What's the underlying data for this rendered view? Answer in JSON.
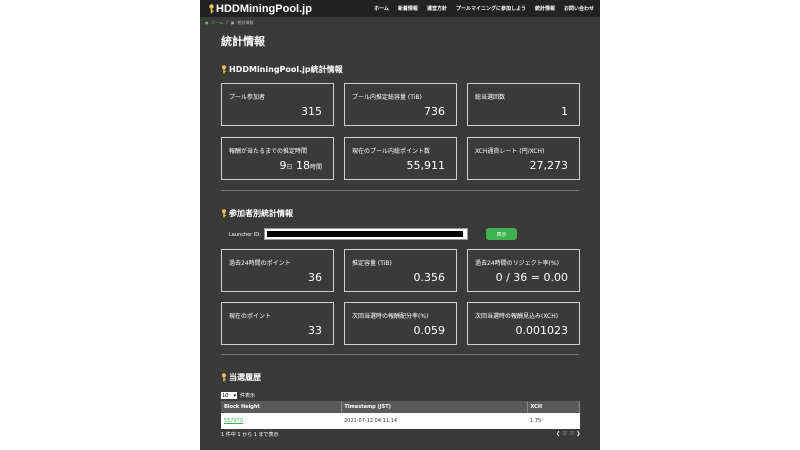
{
  "header": {
    "brand": "HDDMiningPool.jp",
    "nav": [
      "ホーム",
      "新着情報",
      "運営方針",
      "プールマイニングに参加しよう",
      "統計情報",
      "お問い合わせ"
    ]
  },
  "breadcrumb": {
    "home": "ホーム",
    "separator": "/",
    "current": "統計情報"
  },
  "page_title": "統計情報",
  "pool_stats": {
    "title": "HDDMiningPool.jp統計情報",
    "cards": [
      {
        "label": "プール参加者",
        "value": "315"
      },
      {
        "label": "プール内推定総容量 (TiB)",
        "value": "736"
      },
      {
        "label": "総当選回数",
        "value": "1"
      },
      {
        "label": "報酬が当たるまでの推定時間",
        "days": "9",
        "days_unit": "日",
        "hours": "18",
        "hours_unit": "時間"
      },
      {
        "label": "現在のプール内総ポイント数",
        "value": "55,911"
      },
      {
        "label": "XCH通貨レート (円/XCH)",
        "value": "27,273"
      }
    ]
  },
  "participant_stats": {
    "title": "参加者別統計情報",
    "launcher_label": "Launcher ID:",
    "show_button": "表示",
    "cards": [
      {
        "label": "過去24時間のポイント",
        "value": "36"
      },
      {
        "label": "推定容量 (TiB)",
        "value": "0.356"
      },
      {
        "label": "過去24時間のリジェクト率(%)",
        "value": "0 / 36 = 0.00"
      },
      {
        "label": "現在のポイント",
        "value": "33"
      },
      {
        "label": "次回当選時の報酬配分率(%)",
        "value": "0.059"
      },
      {
        "label": "次回当選時の報酬見込み(XCH)",
        "value": "0.001023"
      }
    ]
  },
  "history": {
    "title": "当選履歴",
    "page_length": "10",
    "page_length_suffix": "件表示",
    "columns": [
      "Block Height",
      "Timestamp (JST)",
      "XCH"
    ],
    "rows": [
      {
        "block_height": "557970",
        "timestamp": "2021-07-12 04:11:14",
        "xch": "1.75"
      }
    ],
    "info": "1 件中 1 から 1 まで表示",
    "pager": {
      "prev": "前",
      "next": "次"
    }
  },
  "colors": {
    "background": "#3a3a3a",
    "navbar": "#222222",
    "accent_green": "#3fb24f",
    "card_border": "#cfcfcf"
  }
}
